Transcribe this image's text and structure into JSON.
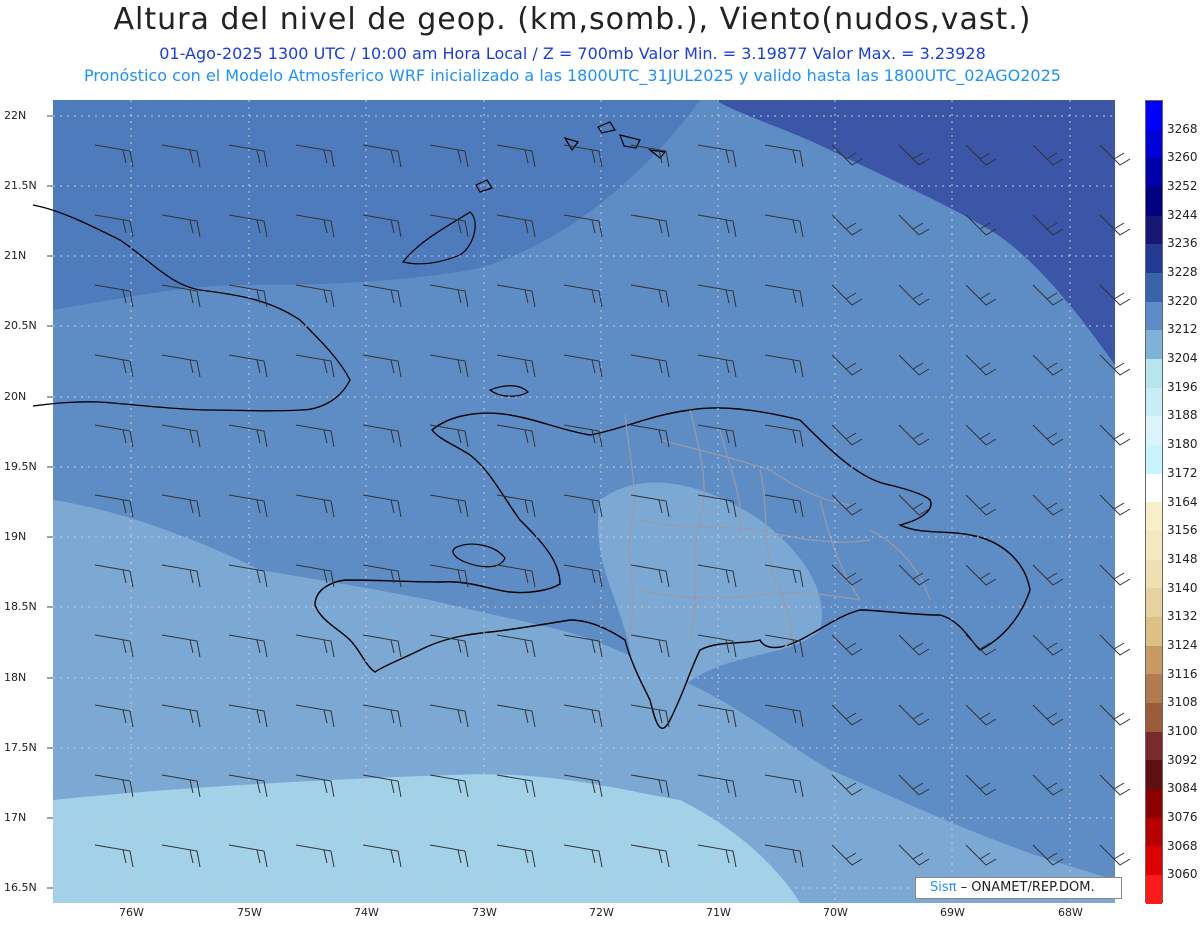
{
  "header": {
    "title": "Altura del nivel de geop. (km,somb.), Viento(nudos,vast.)",
    "subtitle": "01-Ago-2025  1300 UTC / 10:00 am Hora Local / Z = 700mb   Valor Min. = 3.19877  Valor Max. = 3.23928",
    "model_line": "Pronóstico con el Modelo Atmosferico WRF inicializado a las 1800UTC_31JUL2025 y valido hasta las  1800UTC_02AGO2025"
  },
  "map": {
    "lat_labels": [
      "22N",
      "21.5N",
      "21N",
      "20.5N",
      "20N",
      "19.5N",
      "19N",
      "18.5N",
      "18N",
      "17.5N",
      "17N",
      "16.5N"
    ],
    "lon_labels": [
      "76W",
      "75W",
      "74W",
      "73W",
      "72W",
      "71W",
      "70W",
      "69W",
      "68W"
    ],
    "fill_colors": {
      "band_3236": "#3b56a6",
      "band_3228": "#4e7bbb",
      "band_3220": "#5e8cc5",
      "band_3212": "#7ca8d4",
      "band_3204": "#a3d1e8",
      "band_3196": "#bfe6f2"
    },
    "wind": "northeast trade winds, barbs pointing toward east-northeast, roughly 10-15 knots"
  },
  "colorbar": {
    "labels": [
      "3268",
      "3260",
      "3252",
      "3244",
      "3236",
      "3228",
      "3220",
      "3212",
      "3204",
      "3196",
      "3188",
      "3180",
      "3172",
      "3164",
      "3156",
      "3148",
      "3140",
      "3132",
      "3124",
      "3116",
      "3108",
      "3100",
      "3092",
      "3084",
      "3076",
      "3068",
      "3060"
    ],
    "colors": [
      "#0000ff",
      "#0000d8",
      "#0000a8",
      "#000080",
      "#161873",
      "#243a95",
      "#3a62ad",
      "#5b8cc5",
      "#7fb2d8",
      "#b8e4f0",
      "#c9ecf5",
      "#dbf3fa",
      "#c9f4fb",
      "#ffffff",
      "#f8efc8",
      "#f3e8bf",
      "#efdfb3",
      "#e8d1a0",
      "#ddbf87",
      "#c99964",
      "#b27a4d",
      "#9b5c3b",
      "#7a2a2a",
      "#5c1010",
      "#8c0000",
      "#b80000",
      "#dc0000",
      "#ff1a1a"
    ]
  },
  "credit": {
    "brand": "Sisπ",
    "org": " –  ONAMET/REP.DOM."
  }
}
